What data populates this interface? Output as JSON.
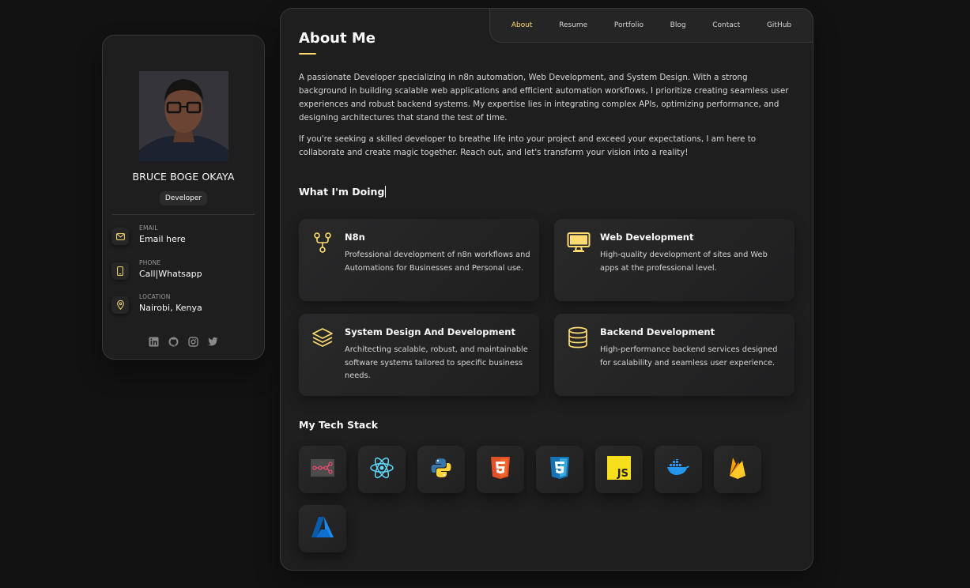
{
  "colors": {
    "accent": "#ffdb70",
    "bg": "#121212",
    "panel": "#1e1e1f"
  },
  "profile": {
    "name": "BRUCE BOGE OKAYA",
    "role": "Developer",
    "contacts": [
      {
        "label": "EMAIL",
        "value": "Email here",
        "icon": "mail-icon"
      },
      {
        "label": "PHONE",
        "value": "Call|Whatsapp",
        "icon": "phone-icon"
      },
      {
        "label": "LOCATION",
        "value": "Nairobi, Kenya",
        "icon": "location-icon"
      }
    ],
    "socials": [
      "linkedin-icon",
      "github-icon",
      "instagram-icon",
      "twitter-icon"
    ]
  },
  "nav": {
    "items": [
      "About",
      "Resume",
      "Portfolio",
      "Blog",
      "Contact",
      "GitHub"
    ],
    "active": "About"
  },
  "about": {
    "title": "About Me",
    "paragraphs": [
      "A passionate Developer specializing in n8n automation, Web Development, and System Design. With a strong background in building scalable web applications and efficient automation workflows, I prioritize creating seamless user experiences and robust backend systems. My expertise lies in integrating complex APIs, optimizing performance, and designing architectures that stand the test of time.",
      "If you're seeking a skilled developer to breathe life into your project and exceed your expectations, I am here to collaborate and create magic together. Reach out, and let's transform your vision into a reality!"
    ]
  },
  "services": {
    "title": "What I'm Doing",
    "items": [
      {
        "title": "N8n",
        "text": "Professional development of n8n workflows and Automations for Businesses and Personal use.",
        "icon": "workflow-icon"
      },
      {
        "title": "Web Development",
        "text": "High-quality development of sites and Web apps at the professional level.",
        "icon": "monitor-icon"
      },
      {
        "title": "System Design And Development",
        "text": "Architecting scalable, robust, and maintainable software systems tailored to specific business needs.",
        "icon": "layers-icon"
      },
      {
        "title": "Backend Development",
        "text": "High-performance backend services designed for scalability and seamless user experience.",
        "icon": "database-icon"
      }
    ]
  },
  "tech_stack": {
    "title": "My Tech Stack",
    "items": [
      "n8n-icon",
      "react-icon",
      "python-icon",
      "html5-icon",
      "css3-icon",
      "javascript-icon",
      "docker-icon",
      "firebase-icon",
      "azure-icon"
    ]
  }
}
